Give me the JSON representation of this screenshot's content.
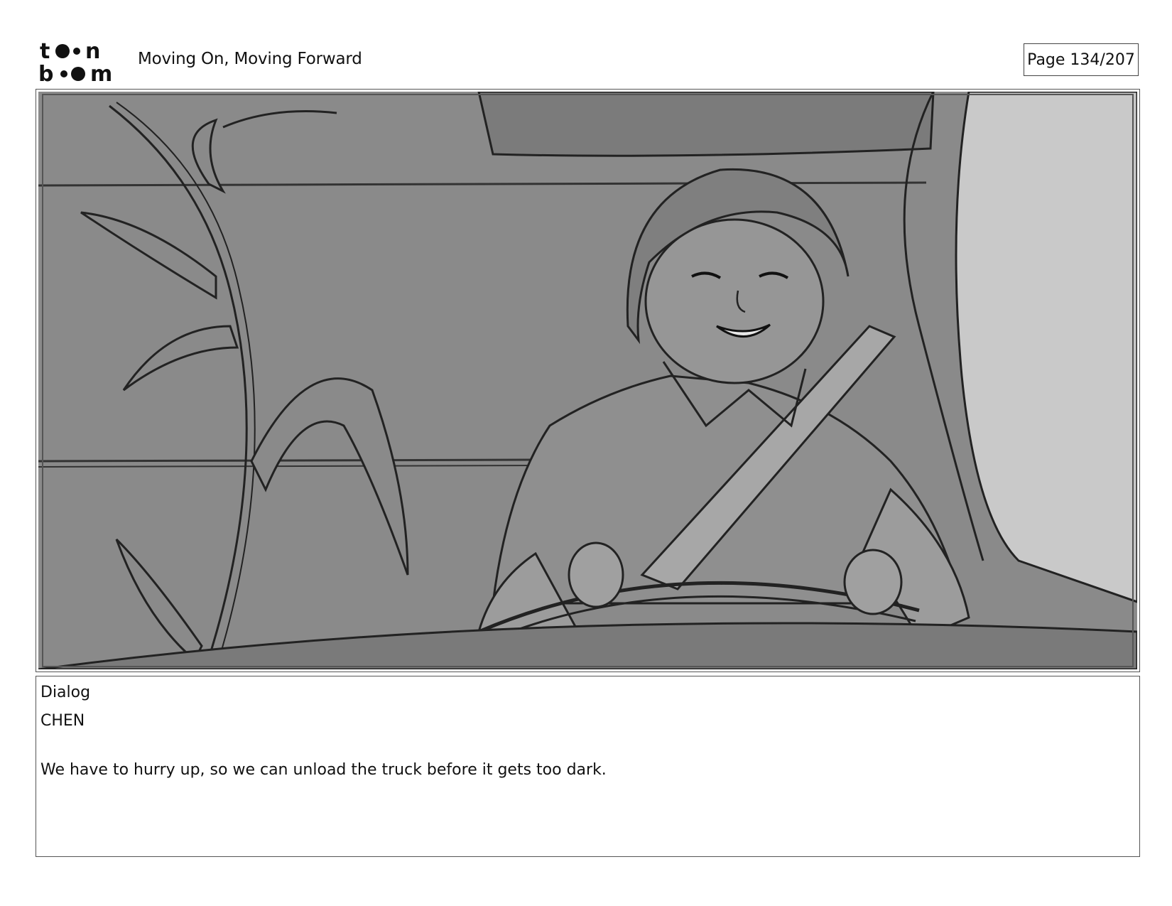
{
  "header": {
    "logo_icon": "toon-boom-logo-icon",
    "title": "Moving On, Moving Forward",
    "page": "Page 134/207"
  },
  "panel": {
    "image": "storyboard-sketch-driver-in-truck"
  },
  "dialog": {
    "heading": "Dialog",
    "character": "CHEN",
    "line": "We have to hurry up, so we can unload the truck before it gets too dark."
  }
}
